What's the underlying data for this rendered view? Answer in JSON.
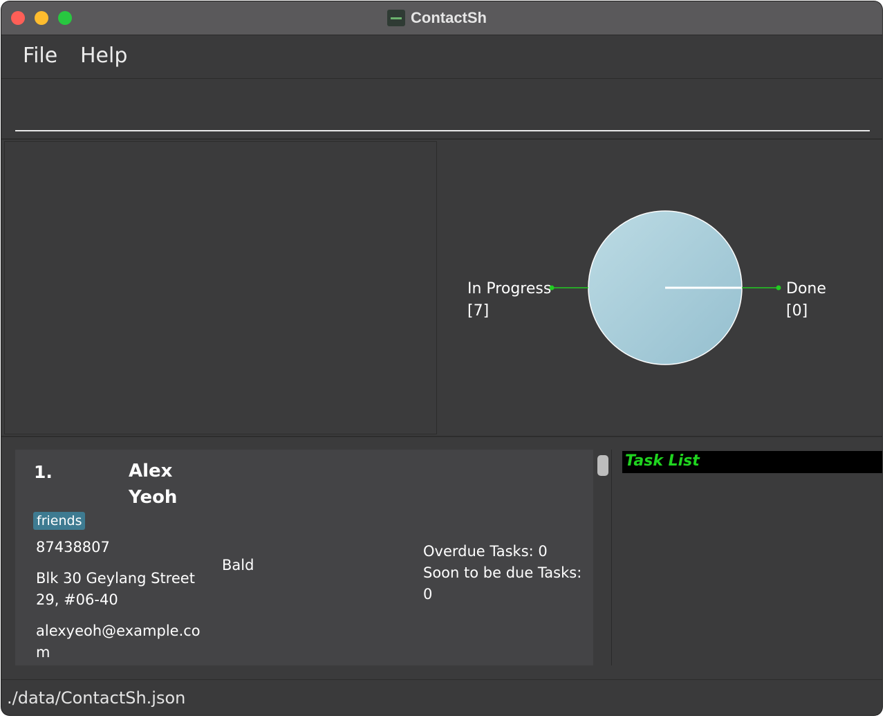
{
  "window": {
    "title": "ContactSh"
  },
  "menu": {
    "items": [
      "File",
      "Help"
    ]
  },
  "command": {
    "value": "",
    "placeholder": ""
  },
  "chart_data": {
    "type": "pie",
    "categories": [
      "In Progress",
      "Done"
    ],
    "values": [
      7,
      0
    ],
    "labels": [
      "In Progress\n[7]",
      "Done\n[0]"
    ],
    "colors": {
      "fill": "#a9ccd8",
      "leader": "#22cc22",
      "label": "#ffffff"
    }
  },
  "contact": {
    "index": "1.",
    "name_line1": "Alex",
    "name_line2": "Yeoh",
    "tag": "friends",
    "phone": "87438807",
    "address_line1": "Blk 30 Geylang Street",
    "address_line2": "29, #06-40",
    "email_line1": "alexyeoh@example.co",
    "email_line2": "m",
    "remark": "Bald",
    "overdue": "Overdue Tasks: 0",
    "soon_due": "Soon to be due Tasks: 0"
  },
  "tasklist": {
    "title": "Task List"
  },
  "status": {
    "path": "./data/ContactSh.json"
  },
  "colors": {
    "tag": "#3e7b91",
    "tasklist_title": "#1fd31f"
  }
}
